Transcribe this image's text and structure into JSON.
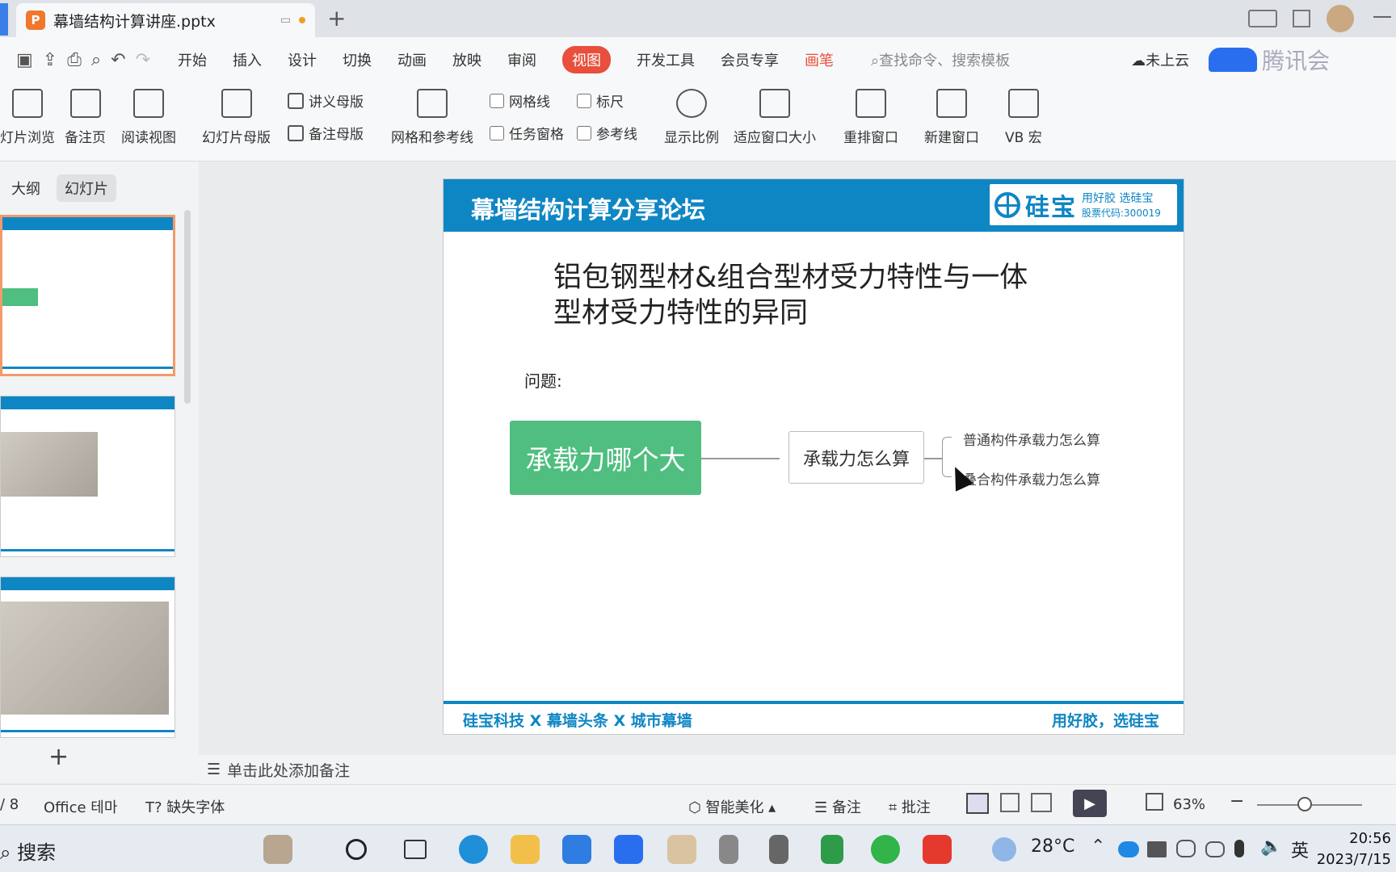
{
  "titlebar": {
    "doc_title": "幕墙结构计算讲座.pptx",
    "new_tab": "+"
  },
  "menu": {
    "items": [
      "开始",
      "插入",
      "设计",
      "切换",
      "动画",
      "放映",
      "审阅",
      "视图",
      "开发工具",
      "会员专享",
      "画笔"
    ],
    "active": "视图",
    "search_placeholder": "查找命令、搜索模板",
    "cloud_status": "未上云",
    "watermark": "腾讯会"
  },
  "ribbon": {
    "slide_browse": "灯片浏览",
    "notes_page": "备注页",
    "reading_view": "阅读视图",
    "slide_master": "幻灯片母版",
    "handout_master": "讲义母版",
    "notes_master": "备注母版",
    "grid_guides": "网格和参考线",
    "gridlines": "网格线",
    "ruler": "标尺",
    "task_pane": "任务窗格",
    "guides": "参考线",
    "zoom": "显示比例",
    "fit_window": "适应窗口大小",
    "arrange": "重排窗口",
    "new_window": "新建窗口",
    "vb": "VB 宏"
  },
  "panel": {
    "tab_outline": "大纲",
    "tab_slides": "幻灯片",
    "add": "+"
  },
  "slide": {
    "header_title": "幕墙结构计算分享论坛",
    "logo_name": "硅宝",
    "logo_slogan": "用好胶 选硅宝",
    "logo_code": "股票代码:300019",
    "title": "铝包钢型材&组合型材受力特性与一体型材受力特性的异同",
    "question": "问题:",
    "node_main": "承载力哪个大",
    "node_mid": "承载力怎么算",
    "branch1": "普通构件承载力怎么算",
    "branch2": "叠合构件承载力怎么算",
    "footer_left": "硅宝科技 X 幕墙头条 X 城市幕墙",
    "footer_right": "用好胶，选硅宝"
  },
  "notes": {
    "placeholder": "单击此处添加备注"
  },
  "status": {
    "page": "/ 8",
    "theme": "Office 테마",
    "missing_font": "缺失字体",
    "beautify": "智能美化",
    "notes": "备注",
    "comments": "批注",
    "zoom": "63%"
  },
  "taskbar": {
    "search": "搜索",
    "temp": "28°C",
    "lang": "英",
    "time": "20:56",
    "date": "2023/7/15"
  },
  "colors": {
    "accent": "#e84f3c",
    "brand_blue": "#0f86c4",
    "green": "#4fbe7f"
  }
}
